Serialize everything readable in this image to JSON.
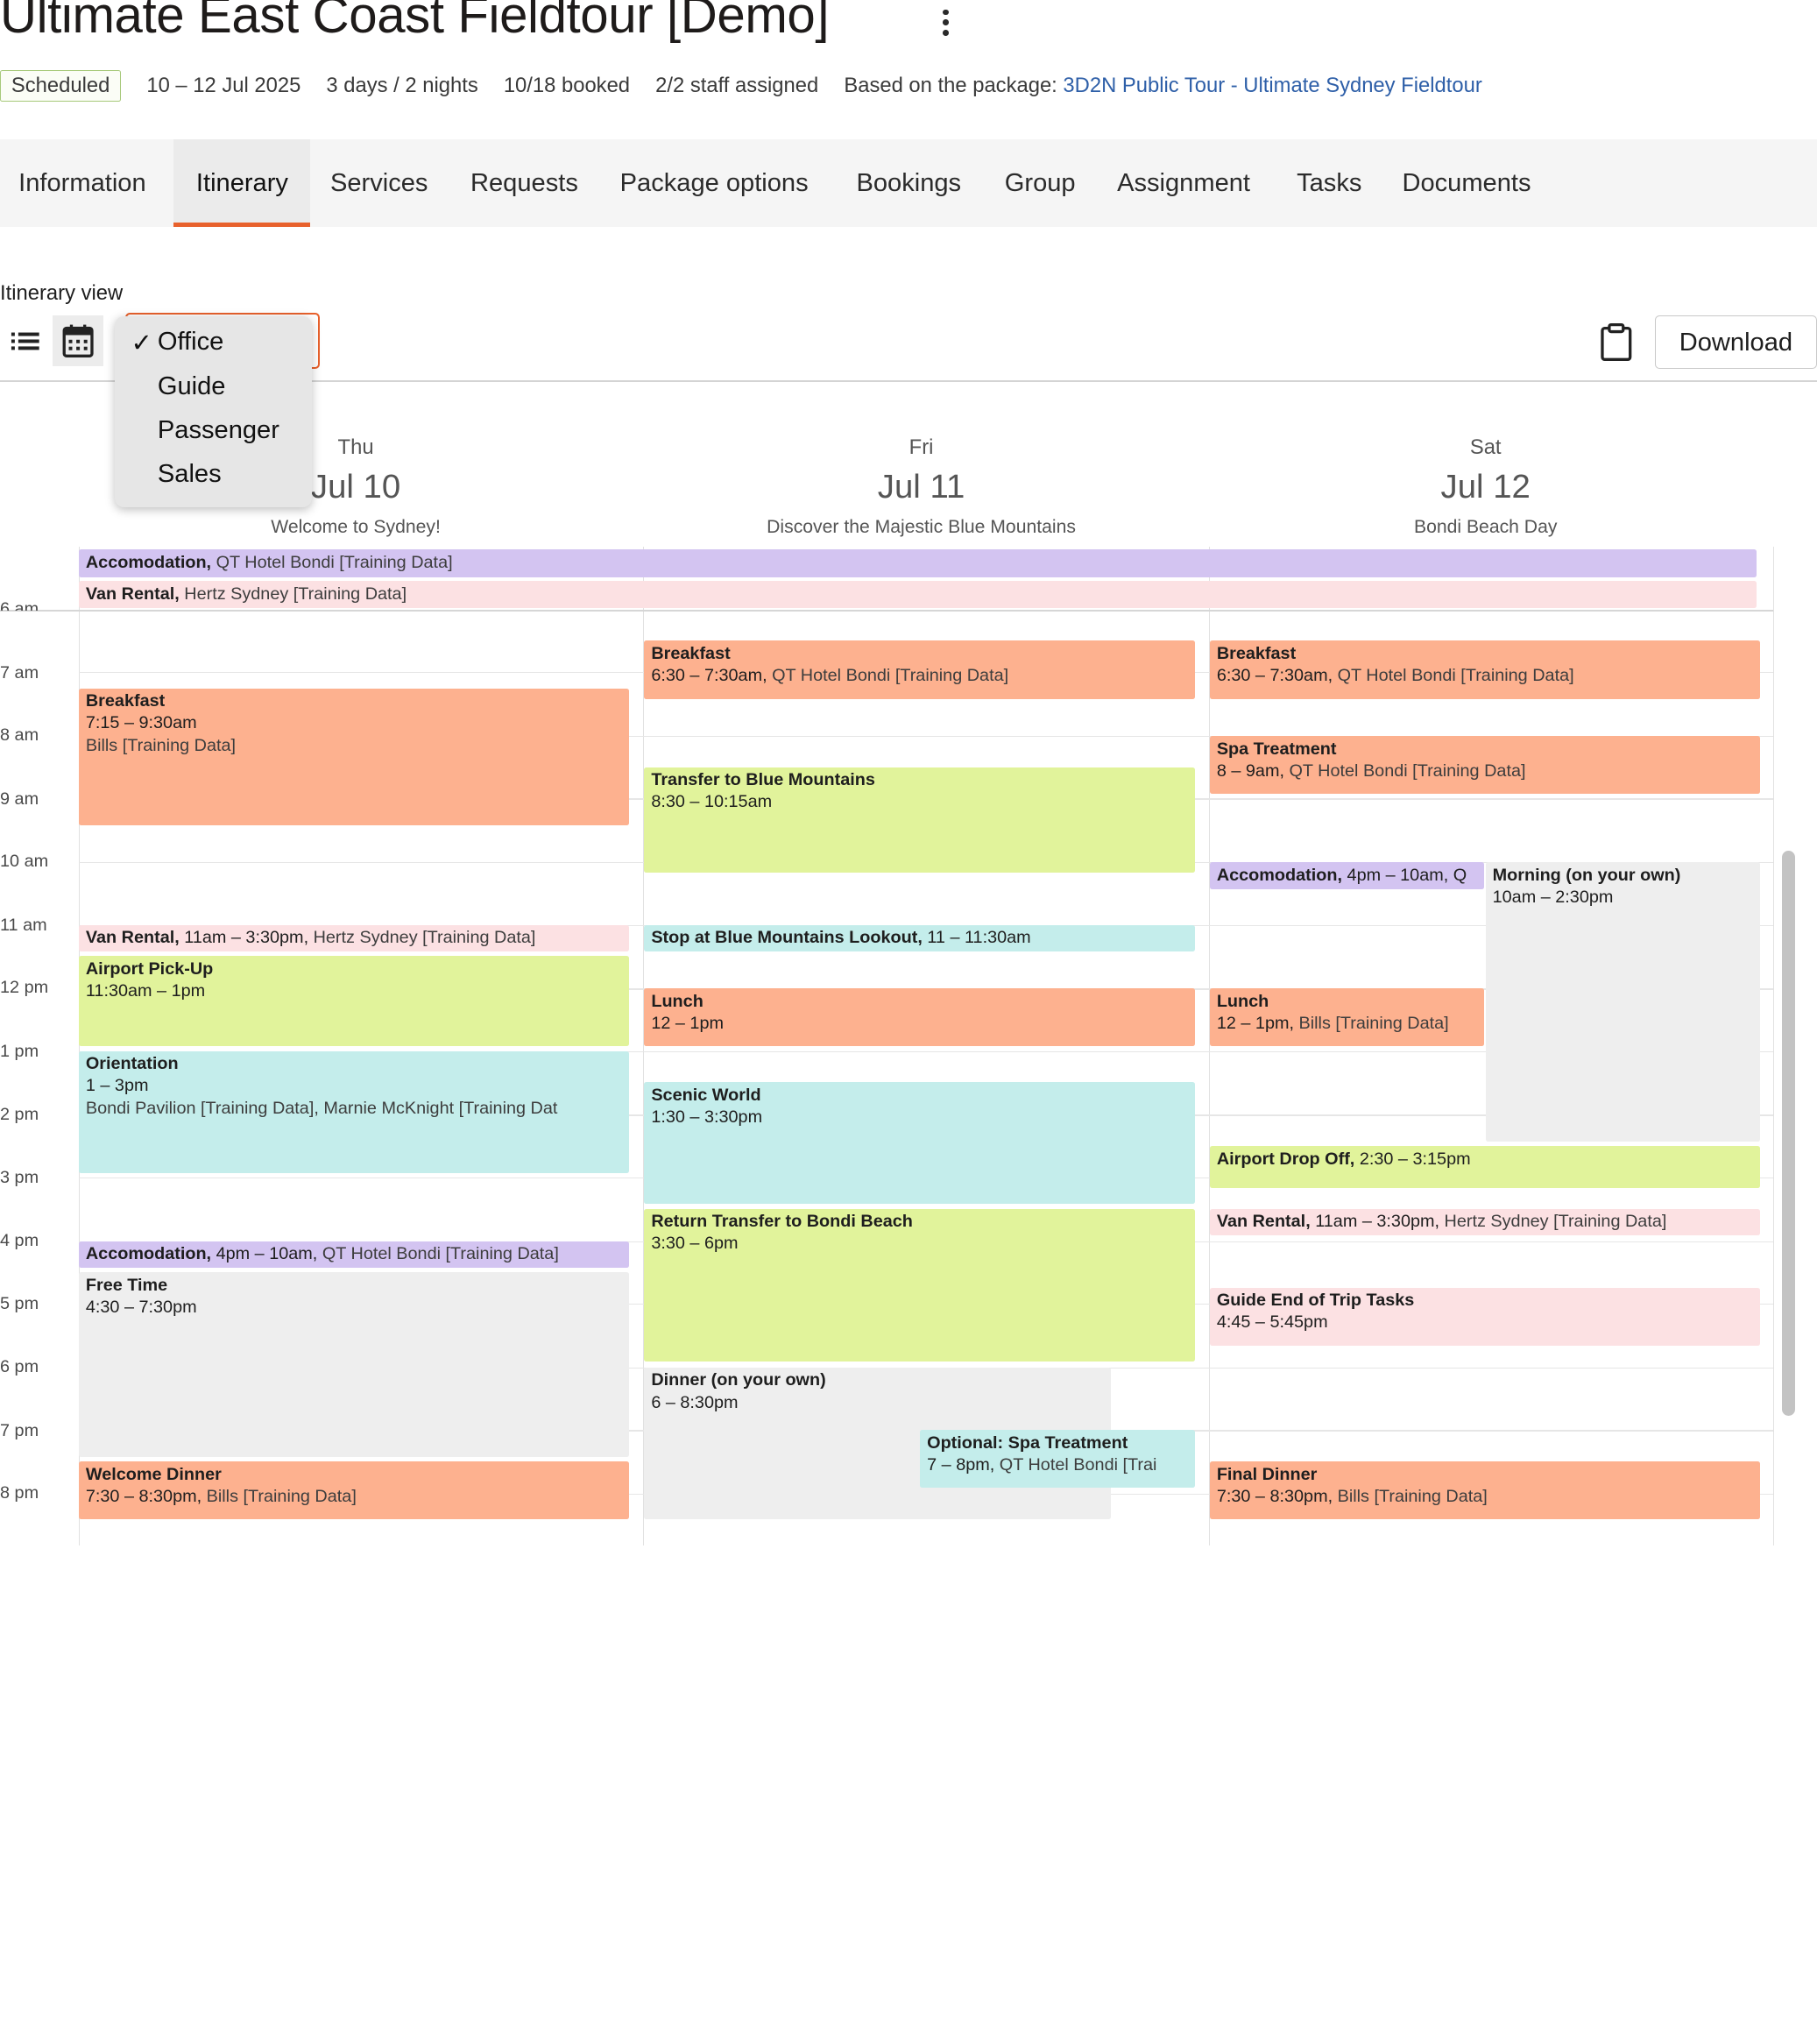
{
  "header": {
    "title": "Ultimate East Coast Fieldtour [Demo]",
    "status": "Scheduled",
    "dates": "10 – 12 Jul 2025",
    "duration": "3 days / 2 nights",
    "booked": "10/18 booked",
    "staff": "2/2 staff assigned",
    "package_prefix": "Based on the package:",
    "package_link": "3D2N Public Tour - Ultimate Sydney Fieldtour"
  },
  "tabs": [
    "Information",
    "Itinerary",
    "Services",
    "Requests",
    "Package options",
    "Bookings",
    "Group",
    "Assignment",
    "Tasks",
    "Documents"
  ],
  "active_tab": "Itinerary",
  "toolbar": {
    "label": "Itinerary view",
    "view_options": [
      "Office",
      "Guide",
      "Passenger",
      "Sales"
    ],
    "selected_view": "Office",
    "check_mark": "✓",
    "download_label": "Download"
  },
  "days": [
    {
      "dow": "Thu",
      "date": "Jul 10",
      "subtitle": "Welcome to Sydney!"
    },
    {
      "dow": "Fri",
      "date": "Jul 11",
      "subtitle": "Discover the Majestic Blue Mountains"
    },
    {
      "dow": "Sat",
      "date": "Jul 12",
      "subtitle": "Bondi Beach Day"
    }
  ],
  "all_day": [
    {
      "name": "Accomodation,",
      "detail": " QT Hotel Bondi [Training Data]",
      "color": "#d3c4f1"
    },
    {
      "name": "Van Rental,",
      "detail": " Hertz Sydney [Training Data]",
      "color": "#fce1e3"
    }
  ],
  "hours": [
    "6 am",
    "7 am",
    "8 am",
    "9 am",
    "10 am",
    "11 am",
    "12 pm",
    "1 pm",
    "2 pm",
    "3 pm",
    "4 pm",
    "5 pm",
    "6 pm",
    "7 pm",
    "8 pm"
  ],
  "events": {
    "thu": {
      "breakfast": {
        "name": "Breakfast",
        "time": "7:15 – 9:30am",
        "detail": "Bills [Training Data]"
      },
      "van": {
        "name": "Van Rental,",
        "time": " 11am – 3:30pm,",
        "detail": " Hertz Sydney [Training Data]"
      },
      "pickup": {
        "name": "Airport Pick-Up",
        "time": "11:30am – 1pm"
      },
      "orientation": {
        "name": "Orientation",
        "time": "1 – 3pm",
        "detail": "Bondi Pavilion [Training Data], Marnie McKnight [Training Dat"
      },
      "accom": {
        "name": "Accomodation,",
        "time": " 4pm – 10am,",
        "detail": " QT Hotel Bondi [Training Data]"
      },
      "free": {
        "name": "Free Time",
        "time": "4:30 – 7:30pm"
      },
      "dinner": {
        "name": "Welcome Dinner",
        "time": "7:30 – 8:30pm,",
        "detail": " Bills [Training Data]"
      }
    },
    "fri": {
      "breakfast": {
        "name": "Breakfast",
        "time": "6:30 – 7:30am,",
        "detail": " QT Hotel Bondi [Training Data]"
      },
      "transfer": {
        "name": "Transfer to Blue Mountains",
        "time": "8:30 – 10:15am"
      },
      "lookout": {
        "name": "Stop at Blue Mountains Lookout,",
        "time": " 11 – 11:30am"
      },
      "lunch": {
        "name": "Lunch",
        "time": "12 – 1pm"
      },
      "scenic": {
        "name": "Scenic World",
        "time": "1:30 – 3:30pm"
      },
      "return": {
        "name": "Return Transfer to Bondi Beach",
        "time": "3:30 – 6pm"
      },
      "dinner": {
        "name": "Dinner (on your own)",
        "time": "6 – 8:30pm"
      },
      "spa": {
        "name": "Optional: Spa Treatment",
        "time": "7 – 8pm,",
        "detail": " QT Hotel Bondi [Trai"
      }
    },
    "sat": {
      "breakfast": {
        "name": "Breakfast",
        "time": "6:30 – 7:30am,",
        "detail": " QT Hotel Bondi [Training Data]"
      },
      "spa": {
        "name": "Spa Treatment",
        "time": "8 – 9am,",
        "detail": " QT Hotel Bondi [Training Data]"
      },
      "accom": {
        "name": "Accomodation,",
        "time": " 4pm – 10am, Q"
      },
      "morning": {
        "name": "Morning (on your own)",
        "time": "10am – 2:30pm"
      },
      "lunch": {
        "name": "Lunch",
        "time": "12 – 1pm,",
        "detail": " Bills [Training Data]"
      },
      "dropoff": {
        "name": "Airport Drop Off,",
        "time": " 2:30 – 3:15pm"
      },
      "van": {
        "name": "Van Rental,",
        "time": " 11am – 3:30pm,",
        "detail": " Hertz Sydney [Training Data]"
      },
      "tasks": {
        "name": "Guide End of Trip Tasks",
        "time": "4:45 – 5:45pm"
      },
      "dinner": {
        "name": "Final Dinner",
        "time": "7:30 – 8:30pm,",
        "detail": " Bills [Training Data]"
      }
    }
  }
}
